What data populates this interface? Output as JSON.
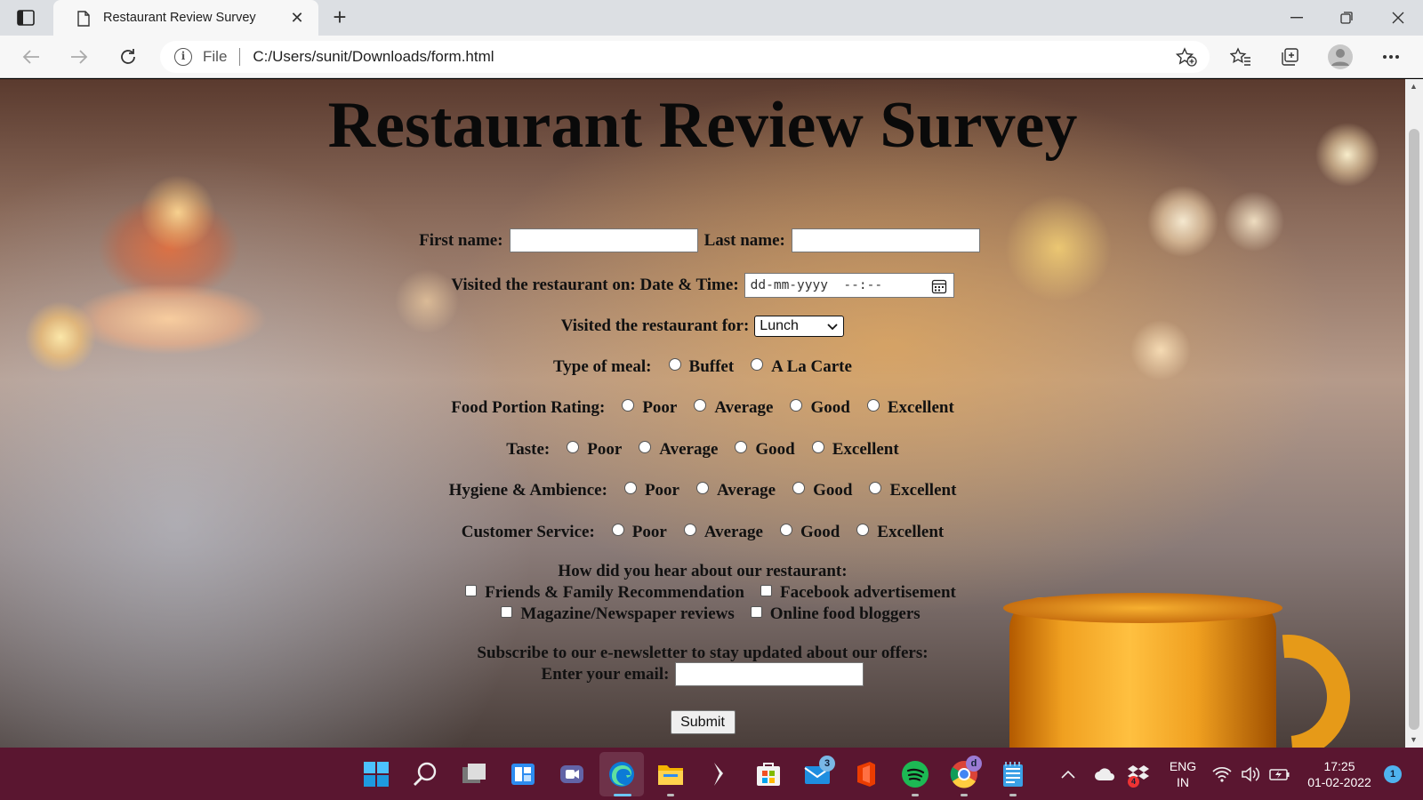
{
  "browser": {
    "tab_title": "Restaurant Review Survey",
    "address_prefix": "File",
    "url": "C:/Users/sunit/Downloads/form.html"
  },
  "page": {
    "heading": "Restaurant Review Survey",
    "first_name_label": "First name:",
    "last_name_label": "Last name:",
    "first_name_value": "",
    "last_name_value": "",
    "visit_datetime_label": "Visited the restaurant on: Date & Time:",
    "visit_datetime_placeholder": "dd-mm-yyyy  --:--",
    "visited_for_label": "Visited the restaurant for:",
    "visited_for_selected": "Lunch",
    "meal_type_label": "Type of meal:",
    "meal_type_options": [
      "Buffet",
      "A La Carte"
    ],
    "ratings": [
      {
        "label": "Food Portion Rating:",
        "options": [
          "Poor",
          "Average",
          "Good",
          "Excellent"
        ]
      },
      {
        "label": "Taste:",
        "options": [
          "Poor",
          "Average",
          "Good",
          "Excellent"
        ]
      },
      {
        "label": "Hygiene & Ambience:",
        "options": [
          "Poor",
          "Average",
          "Good",
          "Excellent"
        ]
      },
      {
        "label": "Customer Service:",
        "options": [
          "Poor",
          "Average",
          "Good",
          "Excellent"
        ]
      }
    ],
    "hear_about_label": "How did you hear about our restaurant:",
    "hear_about_options": [
      "Friends & Family Recommendation",
      "Facebook advertisement",
      "Magazine/Newspaper reviews",
      "Online food bloggers"
    ],
    "newsletter_label": "Subscribe to our e-newsletter to stay updated about our offers:",
    "email_label": "Enter your email:",
    "email_value": "",
    "submit_label": "Submit"
  },
  "taskbar": {
    "mail_badge": "3",
    "chrome_badge": "d",
    "dropbox_badge": "4",
    "language": "ENG",
    "region": "IN",
    "time": "17:25",
    "date": "01-02-2022",
    "notification_count": "1"
  },
  "colors": {
    "taskbar_bg": "#5a1630",
    "tab_bar_bg": "#dcdfe3",
    "toolbar_bg": "#f7f7f7"
  }
}
